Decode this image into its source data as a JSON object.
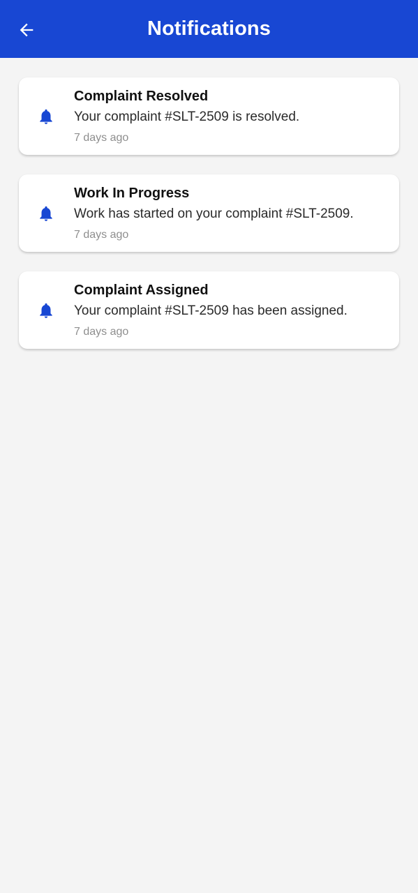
{
  "app_bar": {
    "title": "Notifications",
    "back_icon": "arrow-left-icon",
    "background_color": "#1847d3"
  },
  "notifications": [
    {
      "icon": "bell-icon",
      "title": "Complaint Resolved",
      "message": "Your complaint #SLT-2509 is resolved.",
      "time": "7 days ago"
    },
    {
      "icon": "bell-icon",
      "title": "Work In Progress",
      "message": "Work has started on your complaint #SLT-2509.",
      "time": "7 days ago"
    },
    {
      "icon": "bell-icon",
      "title": "Complaint Assigned",
      "message": "Your complaint #SLT-2509 has been assigned.",
      "time": "7 days ago"
    }
  ],
  "colors": {
    "accent": "#1847d3",
    "background": "#f4f4f4",
    "card": "#ffffff",
    "muted_text": "#8e8e8e"
  }
}
